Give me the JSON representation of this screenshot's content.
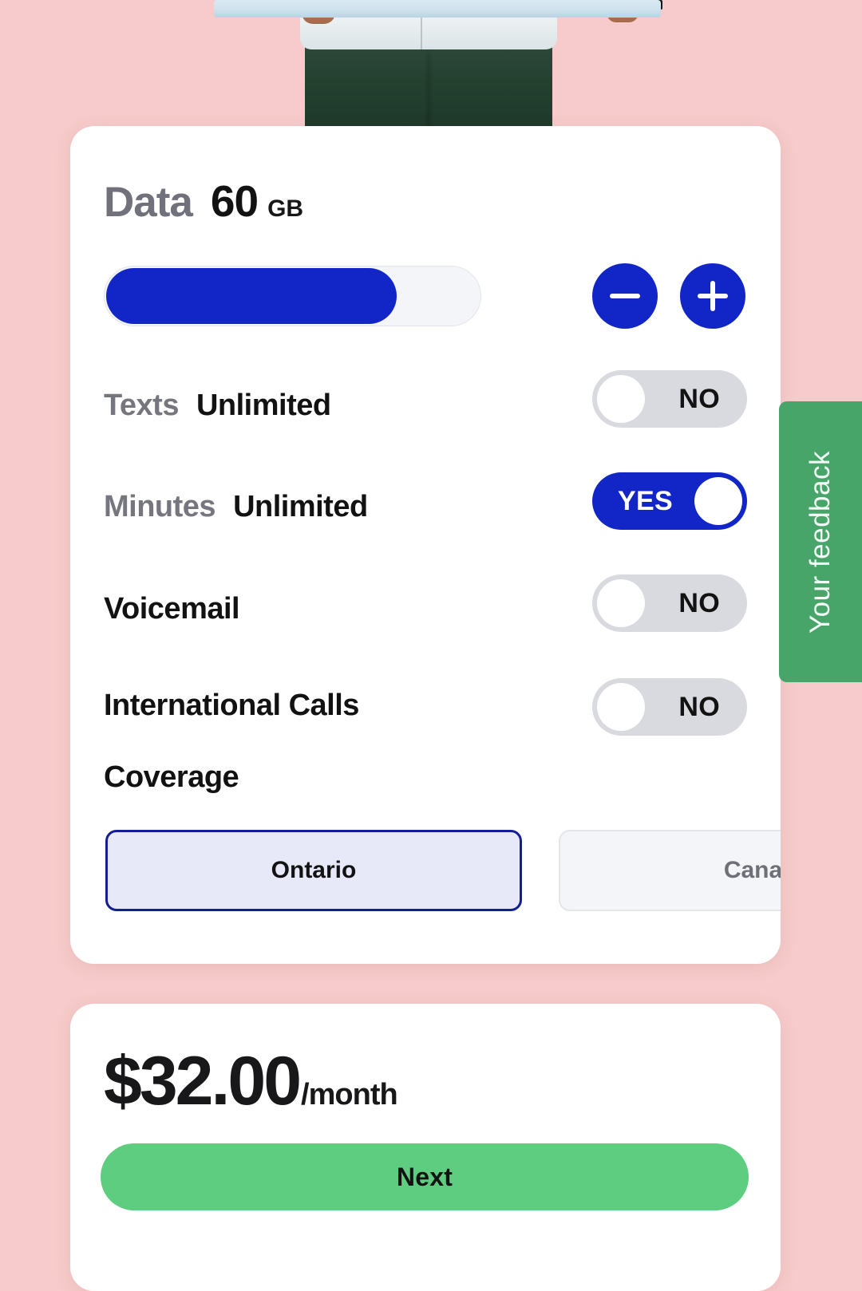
{
  "hero": {
    "alt": "person-holding-device-photo",
    "background_color": "#f7cbcb"
  },
  "options_card": {
    "data": {
      "label": "Data",
      "amount": "60",
      "unit": "GB",
      "slider_fill_percent": 78,
      "decrease_icon": "minus-icon",
      "increase_icon": "plus-icon"
    },
    "features": [
      {
        "name": "texts",
        "label": "Texts",
        "value": "Unlimited",
        "label_muted": true,
        "toggle": "NO",
        "toggle_on": false
      },
      {
        "name": "minutes",
        "label": "Minutes",
        "value": "Unlimited",
        "label_muted": true,
        "toggle": "YES",
        "toggle_on": true
      },
      {
        "name": "voicemail",
        "label": "Voicemail",
        "value": "",
        "label_muted": false,
        "toggle": "NO",
        "toggle_on": false
      },
      {
        "name": "intl",
        "label": "International Calls",
        "value": "",
        "label_muted": false,
        "toggle": "NO",
        "toggle_on": false
      }
    ],
    "coverage": {
      "label": "Coverage",
      "options": [
        {
          "label": "Ontario",
          "selected": true
        },
        {
          "label": "Canada",
          "selected": false
        }
      ]
    }
  },
  "price_card": {
    "amount": "$32.00",
    "period": "/month",
    "next_label": "Next"
  },
  "feedback_tab": {
    "label": "Your feedback"
  },
  "colors": {
    "page_background": "#f7cbcb",
    "accent_blue": "#1226c8",
    "toggle_off_track": "#d9dae0",
    "next_green": "#5fcd7f",
    "feedback_green": "#47a569",
    "muted_text": "#75767e",
    "selected_option_fill": "#e7e8f8",
    "selected_option_border": "#131f8f"
  }
}
